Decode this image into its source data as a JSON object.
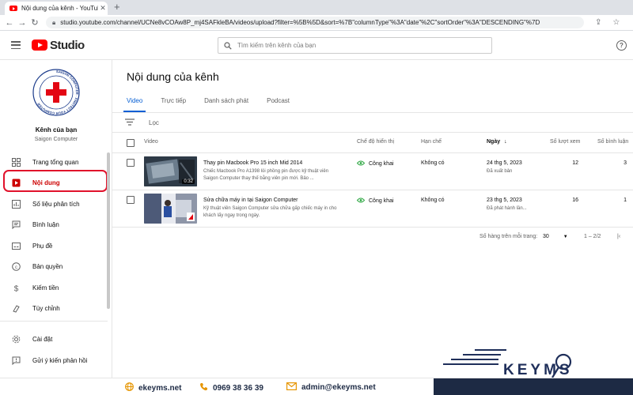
{
  "browser": {
    "tab_title": "Nội dung của kênh - YouTube St",
    "url": "studio.youtube.com/channel/UCNe8vCOAw8P_mj4SAFkleBA/videos/upload?filter=%5B%5D&sort=%7B\"columnType\"%3A\"date\"%2C\"sortOrder\"%3A\"DESCENDING\"%7D"
  },
  "header": {
    "logo_text": "Studio",
    "search_placeholder": "Tìm kiếm trên kênh của bạn"
  },
  "sidebar": {
    "channel_title": "Kênh của bạn",
    "channel_name": "Saigon Computer",
    "logo_ring_text": "SAIGON COMPUTER · PROTECT YOUR COMPUTER",
    "items": [
      {
        "label": "Trang tổng quan",
        "icon": "dashboard-icon"
      },
      {
        "label": "Nội dung",
        "icon": "content-icon",
        "active": true
      },
      {
        "label": "Số liệu phân tích",
        "icon": "analytics-icon"
      },
      {
        "label": "Bình luận",
        "icon": "comments-icon"
      },
      {
        "label": "Phụ đề",
        "icon": "subtitles-icon"
      },
      {
        "label": "Bản quyền",
        "icon": "copyright-icon"
      },
      {
        "label": "Kiếm tiền",
        "icon": "monetization-icon"
      },
      {
        "label": "Tùy chỉnh",
        "icon": "customization-icon"
      },
      {
        "label": "Cài đặt",
        "icon": "settings-icon"
      },
      {
        "label": "Gửi ý kiến phản hồi",
        "icon": "feedback-icon"
      }
    ]
  },
  "main": {
    "title": "Nội dung của kênh",
    "tabs": [
      "Video",
      "Trực tiếp",
      "Danh sách phát",
      "Podcast"
    ],
    "filter_label": "Lọc",
    "columns": {
      "video": "Video",
      "visibility": "Chế độ hiển thị",
      "restrictions": "Hạn chế",
      "date": "Ngày",
      "views": "Số lượt xem",
      "comments": "Số bình luận"
    },
    "rows": [
      {
        "title": "Thay pin Macbook Pro 15 inch Mid 2014",
        "description": "Chiếc Macbook Pro A1398 lỗi phồng pin được kỹ thuật viên Saigon Computer thay thế bằng viên pin mới. Bảo ...",
        "duration": "0:32",
        "visibility": "Công khai",
        "restriction": "Không có",
        "date": "24 thg 5, 2023",
        "date_status": "Đã xuất bản",
        "views": "12",
        "comments": "3"
      },
      {
        "title": "Sửa chữa máy in tại Saigon Computer",
        "description": "Kỹ thuật viên Saigon Computer sửa chữa gấp chiếc máy in cho khách lấy ngay trong ngày.",
        "duration": "",
        "visibility": "Công khai",
        "restriction": "Không có",
        "date": "23 thg 5, 2023",
        "date_status": "Đã phát hành lần...",
        "views": "16",
        "comments": "1"
      }
    ],
    "pagination": {
      "rows_per_page_label": "Số hàng trên mỗi trang:",
      "rows_per_page": "30",
      "range": "1 – 2/2"
    }
  },
  "footer": {
    "website": "ekeyms.net",
    "phone": "0969 38 36 39",
    "email": "admin@ekeyms.net",
    "brand": "KEYMS"
  },
  "colors": {
    "accent_blue": "#065fd4",
    "youtube_red": "#ff0000",
    "highlight_outline": "#e1112b",
    "footer_navy": "#1d2a44"
  }
}
